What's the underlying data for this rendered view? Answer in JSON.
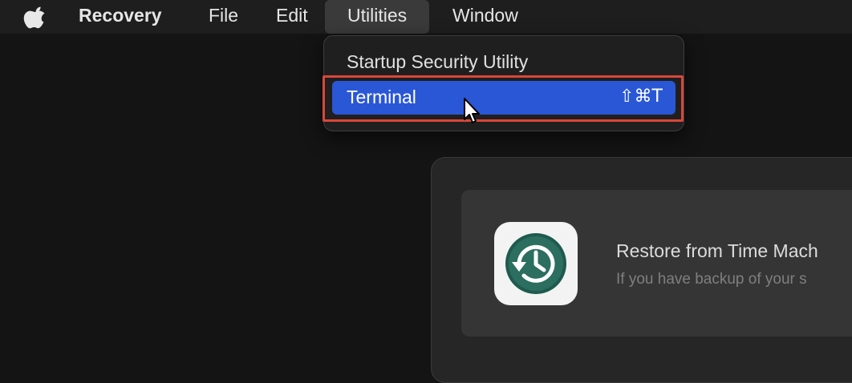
{
  "menubar": {
    "app_name": "Recovery",
    "items": [
      "File",
      "Edit",
      "Utilities",
      "Window"
    ]
  },
  "utilities_menu": {
    "items": [
      {
        "label": "Startup Security Utility",
        "shortcut": ""
      },
      {
        "label": "Terminal",
        "shortcut": "⇧⌘T"
      }
    ],
    "highlight_color": "#2a57d6",
    "annotation_color": "#d8473a"
  },
  "recovery_window": {
    "option": {
      "title": "Restore from Time Mach",
      "subtitle": "If you have backup of your s"
    }
  },
  "icons": {
    "apple": "apple-logo-icon",
    "time_machine": "time-machine-icon",
    "cursor": "mouse-pointer-icon"
  }
}
